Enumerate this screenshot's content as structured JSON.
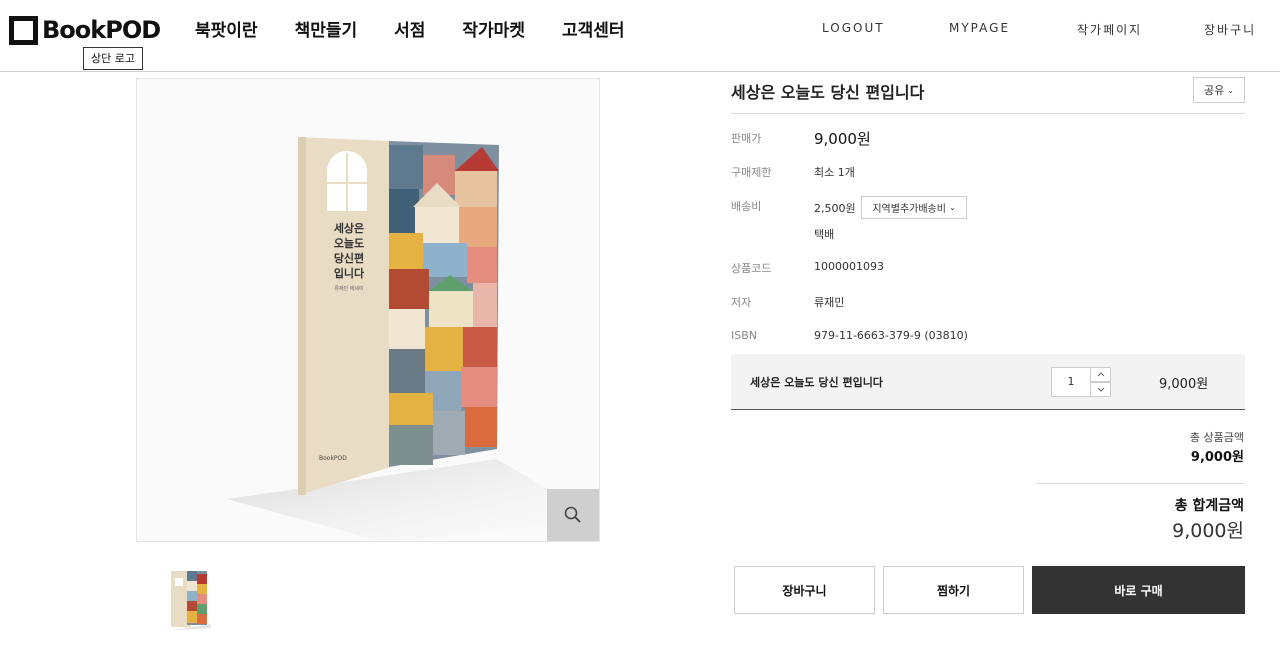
{
  "header": {
    "logo_text": "BookPOD",
    "tooltip": "상단 로고",
    "nav": [
      "북팟이란",
      "책만들기",
      "서점",
      "작가마켓",
      "고객센터"
    ],
    "util": {
      "logout": "LOGOUT",
      "mypage": "MYPAGE",
      "author": "작가페이지",
      "cart": "장바구니"
    }
  },
  "product": {
    "title": "세상은 오늘도 당신 편입니다",
    "share": "공유",
    "cover_title": [
      "세상은",
      "오늘도",
      "당신편",
      "입니다"
    ],
    "cover_author": "류재민 에세이",
    "cover_publisher": "BookPOD",
    "fields": {
      "price_label": "판매가",
      "price": "9,000원",
      "limit_label": "구매제한",
      "limit": "최소 1개",
      "shipping_label": "배송비",
      "shipping": "2,500원",
      "shipping_option": "지역별추가배송비",
      "shipping_method": "택배",
      "code_label": "상품코드",
      "code": "1000001093",
      "author_label": "저자",
      "author": "류재민",
      "isbn_label": "ISBN",
      "isbn": "979-11-6663-379-9 (03810)"
    },
    "option": {
      "name": "세상은 오늘도 당신 편입니다",
      "qty": "1",
      "price": "9,000원"
    },
    "total_label": "총 상품금액",
    "total": "9,000원",
    "grand_label": "총 합계금액",
    "grand": "9,000원"
  },
  "buttons": {
    "cart": "장바구니",
    "wish": "찜하기",
    "buy": "바로 구매"
  },
  "colors": {
    "buy_bg": "#333333",
    "accent": "#111111"
  }
}
